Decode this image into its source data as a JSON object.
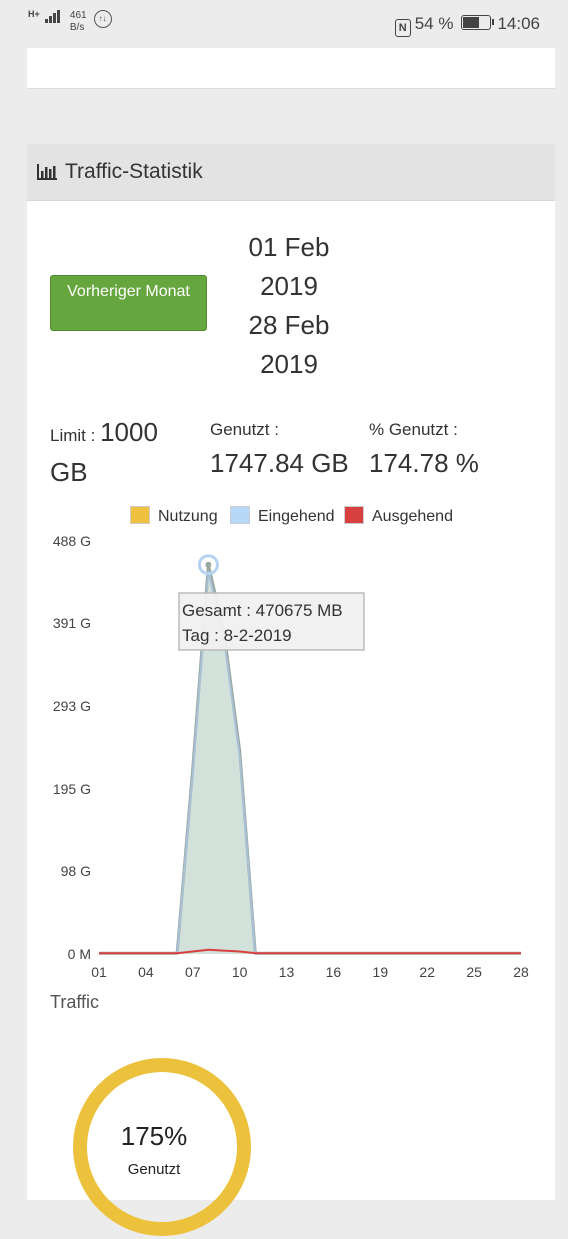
{
  "status_bar": {
    "network": "H+",
    "rate": "461",
    "rate_unit": "B/s",
    "nfc": "N",
    "battery": "54 %",
    "time": "14:06"
  },
  "panel": {
    "title": "Traffic-Statistik",
    "prev_button": "Vorheriger Monat",
    "date_lines": [
      "01 Feb",
      "2019",
      "28 Feb",
      "2019"
    ],
    "limit_label": "Limit :",
    "limit_value": "1000",
    "limit_unit": "GB",
    "used_label": "Genutzt :",
    "used_value": "1747.84 GB",
    "pct_label": "% Genutzt :",
    "pct_value": "174.78 %"
  },
  "legend": [
    {
      "label": "Nutzung",
      "color": "#f0c040"
    },
    {
      "label": "Eingehend",
      "color": "#b8d8f8"
    },
    {
      "label": "Ausgehend",
      "color": "#d84040"
    }
  ],
  "tooltip": {
    "line1": "Gesamt : 470675 MB",
    "line2": "Tag : 8-2-2019"
  },
  "chart_data": {
    "type": "area",
    "y_tick_labels": [
      "488 G",
      "391 G",
      "293 G",
      "195 G",
      "98 G",
      "0 M"
    ],
    "y_ticks": [
      488,
      391,
      293,
      195,
      98,
      0
    ],
    "ylim": [
      0,
      488
    ],
    "x_tick_labels": [
      "01",
      "04",
      "07",
      "10",
      "13",
      "16",
      "19",
      "22",
      "25",
      "28"
    ],
    "x": [
      1,
      2,
      3,
      4,
      5,
      6,
      7,
      8,
      9,
      10,
      11,
      12,
      13,
      14,
      15,
      16,
      17,
      18,
      19,
      20,
      21,
      22,
      23,
      24,
      25,
      26,
      27,
      28
    ],
    "series": [
      {
        "name": "Nutzung",
        "values": [
          1,
          1,
          1,
          1,
          1,
          1,
          220,
          460,
          380,
          240,
          1,
          1,
          1,
          1,
          1,
          1,
          1,
          1,
          1,
          1,
          1,
          1,
          1,
          1,
          1,
          1,
          1,
          1
        ]
      },
      {
        "name": "Eingehend",
        "values": [
          1,
          1,
          1,
          1,
          1,
          1,
          214,
          452,
          373,
          233,
          1,
          1,
          1,
          1,
          1,
          1,
          1,
          1,
          1,
          1,
          1,
          1,
          1,
          1,
          1,
          1,
          1,
          1
        ]
      },
      {
        "name": "Ausgehend",
        "values": [
          1,
          1,
          1,
          1,
          1,
          1,
          3,
          5,
          4,
          3,
          1,
          1,
          1,
          1,
          1,
          1,
          1,
          1,
          1,
          1,
          1,
          1,
          1,
          1,
          1,
          1,
          1,
          1
        ]
      }
    ],
    "highlight": {
      "x": 8,
      "y": 460
    },
    "xlabel": "",
    "ylabel": ""
  },
  "traffic_label": "Traffic",
  "donut": {
    "percent_label": "175%",
    "caption": "Genutzt",
    "ring_color": "#ecc13c",
    "fraction": 1.0
  }
}
